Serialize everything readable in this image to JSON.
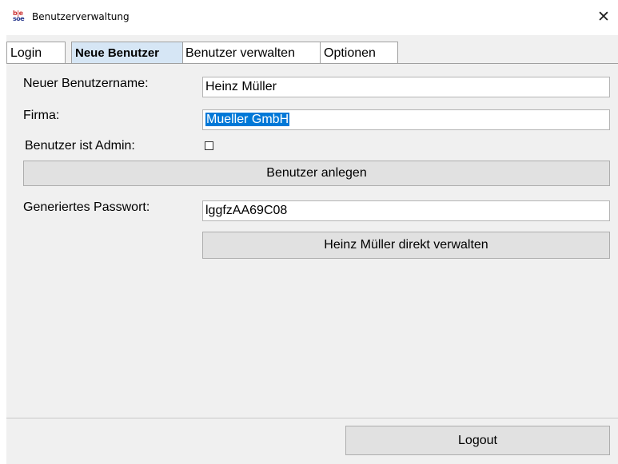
{
  "window": {
    "title": "Benutzerverwaltung",
    "icon": {
      "name": "app-logo-icon",
      "top_text": "b|e",
      "bottom_text": "soe"
    },
    "close_glyph": "✕"
  },
  "tabs": [
    {
      "label": "Login",
      "active": false
    },
    {
      "label": "Neue Benutzer",
      "active": true
    },
    {
      "label": "Benutzer verwalten",
      "active": false
    },
    {
      "label": "Optionen",
      "active": false
    }
  ],
  "form": {
    "username_label": "Neuer Benutzername:",
    "username_value": "Heinz Müller",
    "company_label": "Firma:",
    "company_value": "Mueller GmbH",
    "admin_label": "Benutzer ist Admin:",
    "admin_checked": false,
    "create_button": "Benutzer anlegen",
    "password_label": "Generiertes Passwort:",
    "password_value": "lggfzAA69C08",
    "manage_button": "Heinz Müller direkt verwalten"
  },
  "footer": {
    "logout_button": "Logout"
  },
  "colors": {
    "selection": "#0078d7",
    "active_tab": "#d6e6f5",
    "panel_bg": "#f0f0f0",
    "button_bg": "#e1e1e1"
  }
}
